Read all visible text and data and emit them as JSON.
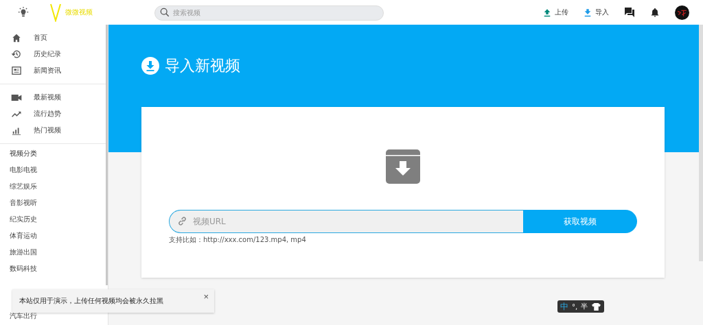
{
  "topbar": {
    "logo_text": "微微视频",
    "search": {
      "placeholder": "搜索视频"
    },
    "actions": [
      {
        "kind": "upload",
        "label": "上传"
      },
      {
        "kind": "import",
        "label": "导入"
      }
    ]
  },
  "sidebar": {
    "main": [
      {
        "kind": "home",
        "label": "首页"
      },
      {
        "kind": "history",
        "label": "历史纪录"
      },
      {
        "kind": "news",
        "label": "新闻资讯"
      }
    ],
    "discover": [
      {
        "kind": "video",
        "label": "最新视频"
      },
      {
        "kind": "trend",
        "label": "流行趋势"
      },
      {
        "kind": "bars",
        "label": "热门视频"
      }
    ],
    "categories_title": "视频分类",
    "categories": [
      "电影电视",
      "综艺娱乐",
      "音影视听",
      "纪实历史",
      "体育运动",
      "旅游出国",
      "数码科技"
    ],
    "last_category": "汽车出行"
  },
  "page": {
    "title": "导入新视频",
    "url_field": {
      "placeholder": "视频URL"
    },
    "submit": "获取视频",
    "hint": "支持比如：http://xxx.com/123.mp4, mp4"
  },
  "toast": {
    "message": "本站仅用于演示，上传任何视频均会被永久拉黑",
    "close": "×"
  },
  "ime": {
    "mode": "中",
    "punct": "°,",
    "width": "半"
  }
}
